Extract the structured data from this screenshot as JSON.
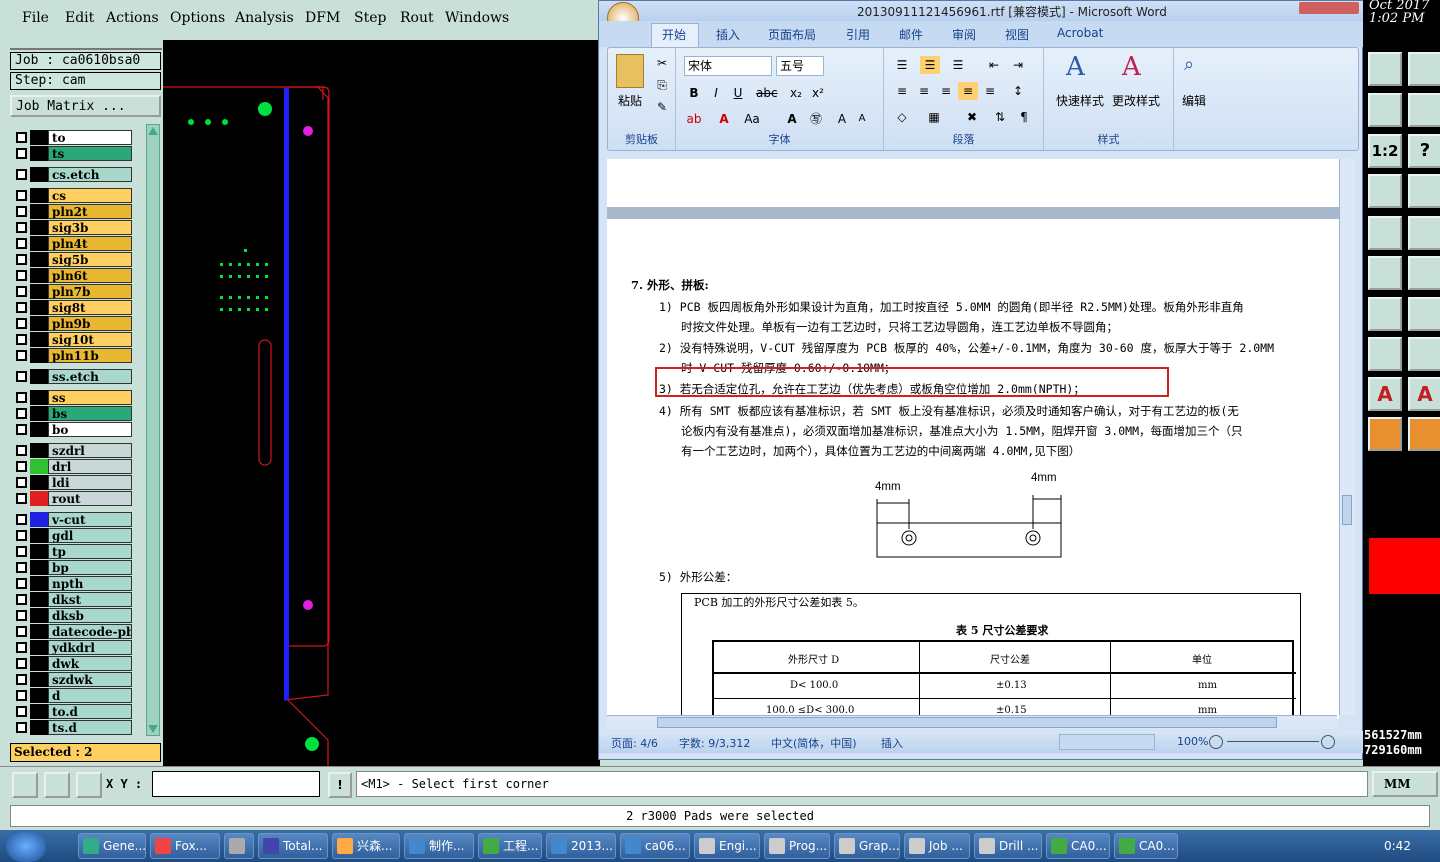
{
  "genesis": {
    "menu": [
      "File",
      "Edit",
      "Actions",
      "Options",
      "Analysis",
      "DFM",
      "Step",
      "Rout",
      "Windows"
    ],
    "job_label": "Job : ca0610bsa0",
    "step_label": "Step: cam",
    "job_matrix_btn": "Job Matrix ...",
    "layers": [
      {
        "name": "to",
        "color": "#ffffff"
      },
      {
        "name": "ts",
        "color": "#2aa878"
      },
      {
        "name": "cs.etch",
        "color": "#a8d8cc"
      },
      {
        "name": "cs",
        "color": "#ffd060"
      },
      {
        "name": "pln2t",
        "color": "#e8b830"
      },
      {
        "name": "sig3b",
        "color": "#ffd060"
      },
      {
        "name": "pln4t",
        "color": "#e8b830"
      },
      {
        "name": "sig5b",
        "color": "#ffd060"
      },
      {
        "name": "pln6t",
        "color": "#e8b830"
      },
      {
        "name": "pln7b",
        "color": "#e8b830"
      },
      {
        "name": "sig8t",
        "color": "#ffd060"
      },
      {
        "name": "pln9b",
        "color": "#e8b830"
      },
      {
        "name": "sig10t",
        "color": "#ffd060"
      },
      {
        "name": "pln11b",
        "color": "#e8b830"
      },
      {
        "name": "ss.etch",
        "color": "#a8d8cc"
      },
      {
        "name": "ss",
        "color": "#ffd060"
      },
      {
        "name": "bs",
        "color": "#2aa878"
      },
      {
        "name": "bo",
        "color": "#ffffff"
      },
      {
        "name": "szdrl",
        "color": "#c8d8d8"
      },
      {
        "name": "drl",
        "color": "#c8d8d8"
      },
      {
        "name": "ldi",
        "color": "#c8d8d8"
      },
      {
        "name": "rout",
        "color": "#c8d8d8"
      },
      {
        "name": "v-cut",
        "color": "#a8d8cc"
      },
      {
        "name": "gdl",
        "color": "#a8d8cc"
      },
      {
        "name": "tp",
        "color": "#a8d8cc"
      },
      {
        "name": "bp",
        "color": "#a8d8cc"
      },
      {
        "name": "npth",
        "color": "#a8d8cc"
      },
      {
        "name": "dkst",
        "color": "#a8d8cc"
      },
      {
        "name": "dksb",
        "color": "#a8d8cc"
      },
      {
        "name": "datecode-pbc",
        "color": "#a8d8cc"
      },
      {
        "name": "ydkdrl",
        "color": "#a8d8cc"
      },
      {
        "name": "dwk",
        "color": "#a8d8cc"
      },
      {
        "name": "szdwk",
        "color": "#a8d8cc"
      },
      {
        "name": "d",
        "color": "#a8d8cc"
      },
      {
        "name": "to.d",
        "color": "#a8d8cc"
      },
      {
        "name": "ts.d",
        "color": "#a8d8cc"
      }
    ],
    "selected": "Selected : 2",
    "xy_label": "X Y :",
    "prompt": "<M1> - Select first corner",
    "status_msg": "2 r3000 Pads were selected",
    "units_btn": "MM",
    "clock_date": "Oct 2017",
    "clock_time": "1:02 PM",
    "coord_x": "561527mm",
    "coord_y": "729160mm"
  },
  "word": {
    "title": "20130911121456961.rtf [兼容模式] - Microsoft Word",
    "tabs": [
      "开始",
      "插入",
      "页面布局",
      "引用",
      "邮件",
      "审阅",
      "视图",
      "Acrobat"
    ],
    "groups": {
      "clipboard": "剪贴板",
      "font": "字体",
      "paragraph": "段落",
      "styles": "样式",
      "edit_group": ""
    },
    "paste": "粘贴",
    "font_name": "宋体",
    "font_size": "五号",
    "quick_styles": "快速样式",
    "change_styles": "更改样式",
    "edit_btn": "编辑",
    "doc": {
      "heading": "7.  外形、拼板:",
      "p1a": "1) PCB 板四周板角外形如果设计为直角，加工时按直径 5.0MM 的圆角(即半径 R2.5MM)处理。板角外形非直角",
      "p1b": "时按文件处理。单板有一边有工艺边时，只将工艺边导圆角，连工艺边单板不导圆角；",
      "p2a": "2) 没有特殊说明，V-CUT 残留厚度为 PCB 板厚的 40%，公差+/-0.1MM，角度为 30-60 度，板厚大于等于 2.0MM",
      "p2b": "时 V  CUT 残留厚度 0.60+/-0.10MM；",
      "p3": "3) 若无合适定位孔，允许在工艺边（优先考虑）或板角空位增加 2.0mm(NPTH)；",
      "p4a": "4) 所有 SMT 板都应该有基准标识，若 SMT 板上没有基准标识，必须及时通知客户确认，对于有工艺边的板(无",
      "p4b": "论板内有没有基准点)，必须双面增加基准标识，基准点大小为 1.5MM，阻焊开窗 3.0MM，每面增加三个（只",
      "p4c": "有一个工艺边时，加两个），具体位置为工艺边的中间离两端 4.0MM,见下图）",
      "dim_left": "4mm",
      "dim_right": "4mm",
      "p5": "5) 外形公差：",
      "table_intro": "PCB 加工的外形尺寸公差如表 5。",
      "table_title": "表 5   尺寸公差要求",
      "table_headers": [
        "外形尺寸 D",
        "尺寸公差",
        "单位"
      ],
      "table_rows": [
        [
          "D< 100.0",
          "±0.13",
          "mm"
        ],
        [
          "100.0 ≤D< 300.0",
          "±0.15",
          "mm"
        ]
      ]
    },
    "status": {
      "page": "页面: 4/6",
      "words": "字数: 9/3,312",
      "lang": "中文(简体，中国)",
      "mode": "插入",
      "zoom": "100%"
    }
  },
  "taskbar": {
    "items": [
      "Gene...",
      "Fox...",
      "",
      "Total...",
      "兴森...",
      "制作...",
      "工程...",
      "2013...",
      "ca06...",
      "Engi...",
      "Prog...",
      "Grap...",
      "Job ...",
      "Drill ...",
      "CA0...",
      "CA0..."
    ],
    "time": "0:42"
  }
}
